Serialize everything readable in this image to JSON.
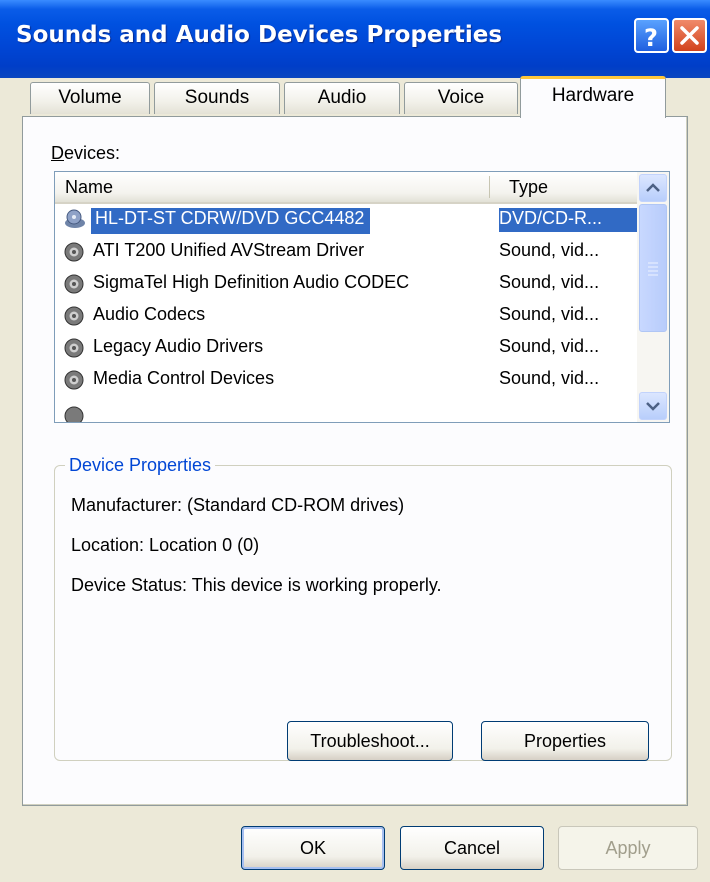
{
  "window": {
    "title": "Sounds and Audio Devices Properties",
    "help_label": "?",
    "close_label": "X"
  },
  "tabs": [
    {
      "label": "Volume"
    },
    {
      "label": "Sounds"
    },
    {
      "label": "Audio"
    },
    {
      "label": "Voice"
    },
    {
      "label": "Hardware",
      "active": true
    }
  ],
  "devices": {
    "label": "Devices:",
    "columns": {
      "name": "Name",
      "type": "Type"
    },
    "rows": [
      {
        "name": "HL-DT-ST CDRW/DVD GCC4482",
        "type": "DVD/CD-R...",
        "icon": "cd-drive-icon",
        "selected": true
      },
      {
        "name": "ATI T200 Unified AVStream Driver",
        "type": "Sound, vid...",
        "icon": "speaker-icon"
      },
      {
        "name": "SigmaTel High Definition Audio CODEC",
        "type": "Sound, vid...",
        "icon": "speaker-icon"
      },
      {
        "name": "Audio Codecs",
        "type": "Sound, vid...",
        "icon": "speaker-icon"
      },
      {
        "name": "Legacy Audio Drivers",
        "type": "Sound, vid...",
        "icon": "speaker-icon"
      },
      {
        "name": "Media Control Devices",
        "type": "Sound, vid...",
        "icon": "speaker-icon"
      }
    ]
  },
  "device_properties": {
    "title": "Device Properties",
    "manufacturer": "Manufacturer: (Standard CD-ROM drives)",
    "location": "Location: Location 0 (0)",
    "status": "Device Status: This device is working properly.",
    "troubleshoot_label": "Troubleshoot...",
    "properties_label": "Properties"
  },
  "dialog_buttons": {
    "ok": "OK",
    "cancel": "Cancel",
    "apply": "Apply"
  },
  "colors": {
    "selection": "#316ac5",
    "title_bar": "#0046d5",
    "active_tab_accent": "#ffc83c"
  }
}
